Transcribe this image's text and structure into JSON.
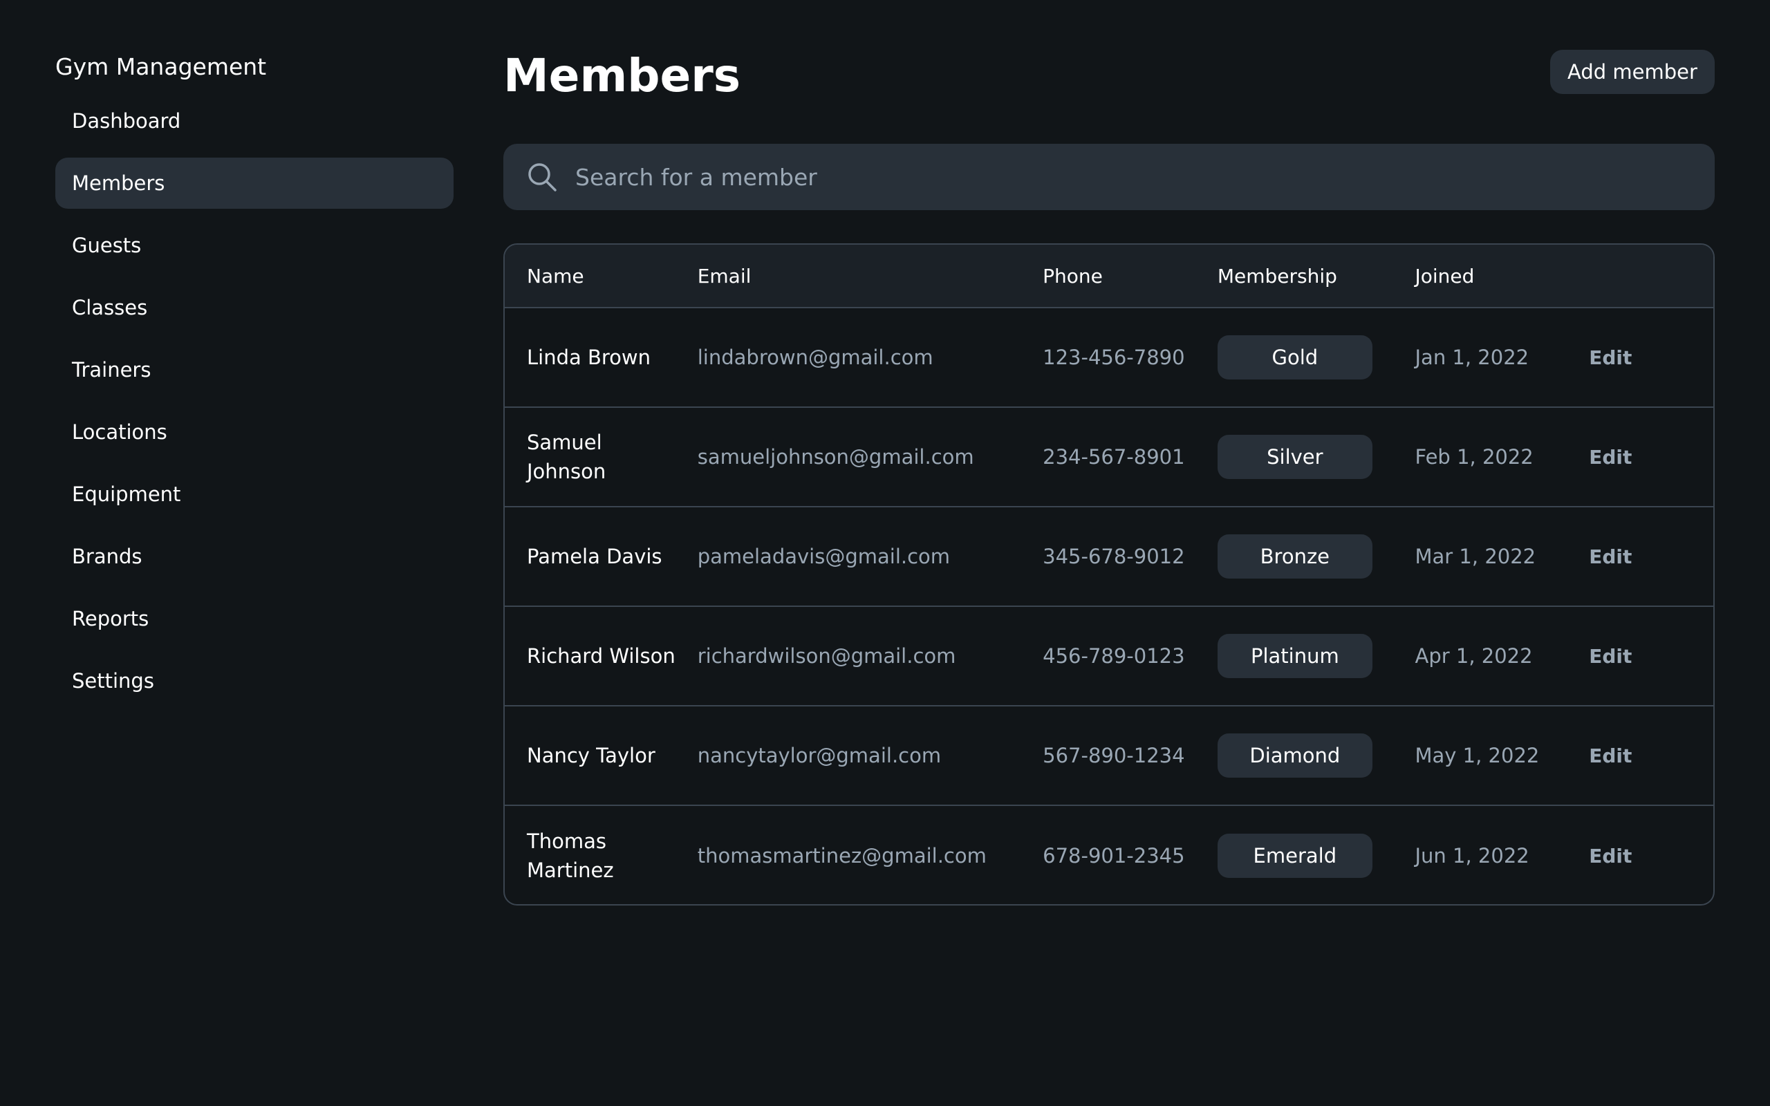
{
  "app": {
    "title": "Gym Management"
  },
  "sidebar": {
    "items": [
      {
        "label": "Dashboard",
        "active": false
      },
      {
        "label": "Members",
        "active": true
      },
      {
        "label": "Guests",
        "active": false
      },
      {
        "label": "Classes",
        "active": false
      },
      {
        "label": "Trainers",
        "active": false
      },
      {
        "label": "Locations",
        "active": false
      },
      {
        "label": "Equipment",
        "active": false
      },
      {
        "label": "Brands",
        "active": false
      },
      {
        "label": "Reports",
        "active": false
      },
      {
        "label": "Settings",
        "active": false
      }
    ]
  },
  "header": {
    "title": "Members",
    "add_button_label": "Add member"
  },
  "search": {
    "placeholder": "Search for a member",
    "value": "",
    "icon": "search-icon"
  },
  "table": {
    "columns": [
      "Name",
      "Email",
      "Phone",
      "Membership",
      "Joined",
      ""
    ],
    "rows": [
      {
        "name": "Linda Brown",
        "email": "lindabrown@gmail.com",
        "phone": "123-456-7890",
        "membership": "Gold",
        "joined": "Jan 1, 2022",
        "action": "Edit"
      },
      {
        "name": "Samuel Johnson",
        "email": "samueljohnson@gmail.com",
        "phone": "234-567-8901",
        "membership": "Silver",
        "joined": "Feb 1, 2022",
        "action": "Edit"
      },
      {
        "name": "Pamela Davis",
        "email": "pameladavis@gmail.com",
        "phone": "345-678-9012",
        "membership": "Bronze",
        "joined": "Mar 1, 2022",
        "action": "Edit"
      },
      {
        "name": "Richard Wilson",
        "email": "richardwilson@gmail.com",
        "phone": "456-789-0123",
        "membership": "Platinum",
        "joined": "Apr 1, 2022",
        "action": "Edit"
      },
      {
        "name": "Nancy Taylor",
        "email": "nancytaylor@gmail.com",
        "phone": "567-890-1234",
        "membership": "Diamond",
        "joined": "May 1, 2022",
        "action": "Edit"
      },
      {
        "name": "Thomas Martinez",
        "email": "thomasmartinez@gmail.com",
        "phone": "678-901-2345",
        "membership": "Emerald",
        "joined": "Jun 1, 2022",
        "action": "Edit"
      }
    ]
  },
  "colors": {
    "background": "#111518",
    "surface": "#283039",
    "table_header": "#1b2127",
    "border": "#3b4550",
    "muted_text": "#9aa7b4",
    "text": "#ffffff"
  }
}
